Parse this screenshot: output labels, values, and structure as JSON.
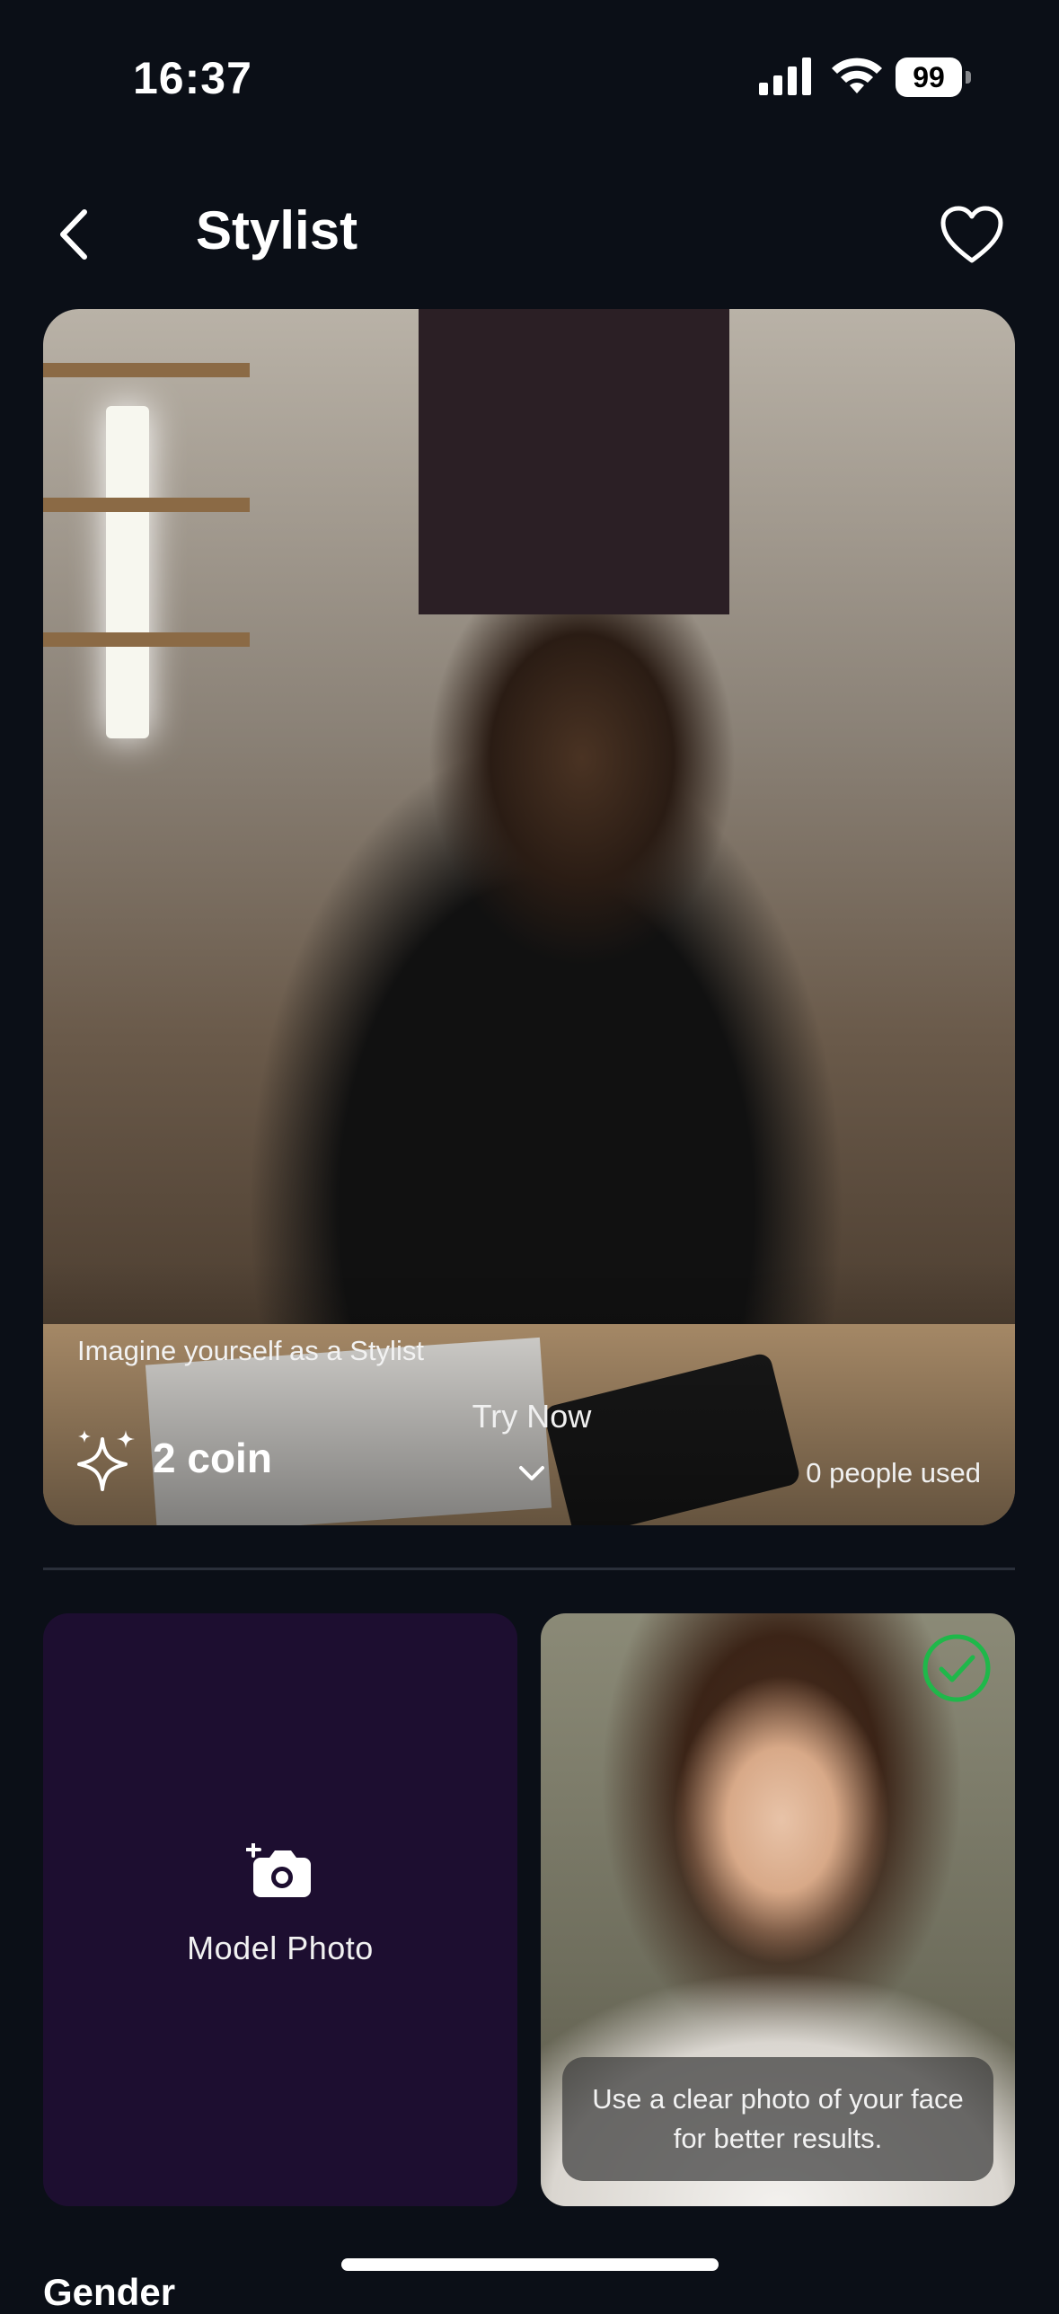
{
  "status_bar": {
    "time": "16:37",
    "battery": "99",
    "icons": [
      "cellular-signal-icon",
      "wifi-icon",
      "battery-icon"
    ]
  },
  "nav": {
    "title": "Stylist",
    "back_icon": "chevron-left-icon",
    "favorite_icon": "heart-outline-icon"
  },
  "hero": {
    "caption": "Imagine yourself as a Stylist",
    "coin": "2 coin",
    "coin_icon": "sparkles-icon",
    "try_now": "Try Now",
    "try_now_icon": "chevron-down-icon",
    "people_used": "0 people used"
  },
  "upload": {
    "model_photo_label": "Model Photo",
    "camera_icon": "add-camera-icon",
    "tip": "Use a clear photo of your face for better results.",
    "selected_icon": "check-circle-icon"
  },
  "section": {
    "gender_label": "Gender"
  },
  "colors": {
    "background": "#0b0f17",
    "card_purple": "#1d0e30",
    "check_green": "#1fb84a",
    "text": "#ffffff"
  }
}
